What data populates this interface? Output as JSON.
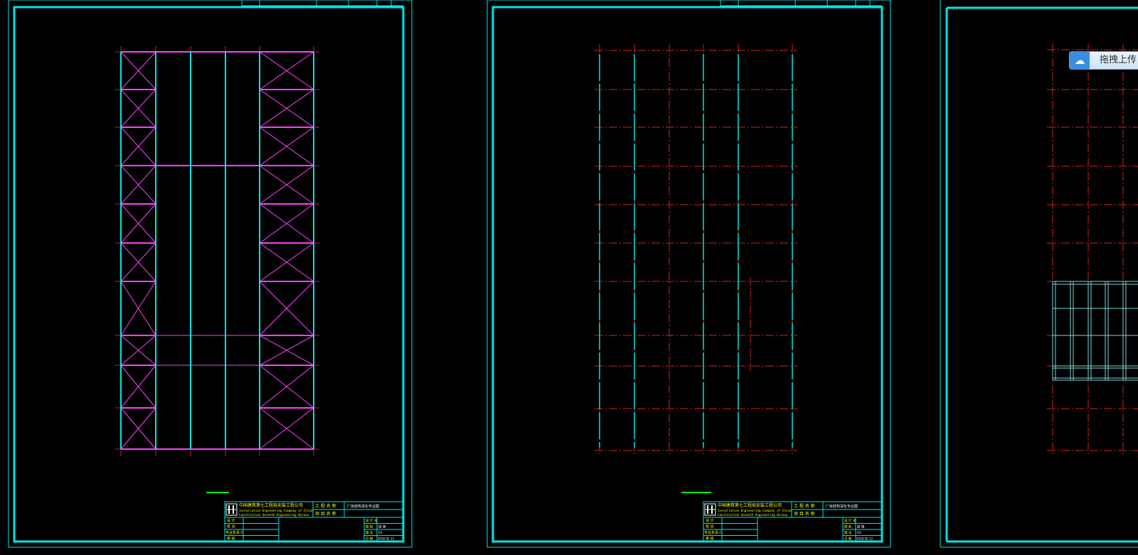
{
  "viewer": {
    "upload_button": {
      "label": "拖拽上传",
      "icon": "cloud-share-icon"
    }
  },
  "title_block": {
    "company_cn": "中国建筑第七工程局安装工程公司",
    "company_en_line1": "Installation Engineering Company of China",
    "company_en_line2": "Construction Seventh Engineering Bureau",
    "project_label": "工 程 名 称",
    "item_label": "项 目 名 称",
    "project_value": "厂房结构深化专业图",
    "roles": [
      "设 计",
      "校 对",
      "专业负责人",
      "审 核"
    ],
    "meta_labels": [
      "设 计 号",
      "图 别",
      "图 号",
      "日 期"
    ],
    "meta_values": [
      "",
      "结 施",
      "01",
      "2016.05.13"
    ]
  },
  "colors": {
    "background": "#000000",
    "frame": "#00e5e5",
    "column": "#00e5e5",
    "bracing": "#ff40ff",
    "axis": "#d42020",
    "title_text": "#ffff00",
    "scale_bar": "#00ff00"
  }
}
